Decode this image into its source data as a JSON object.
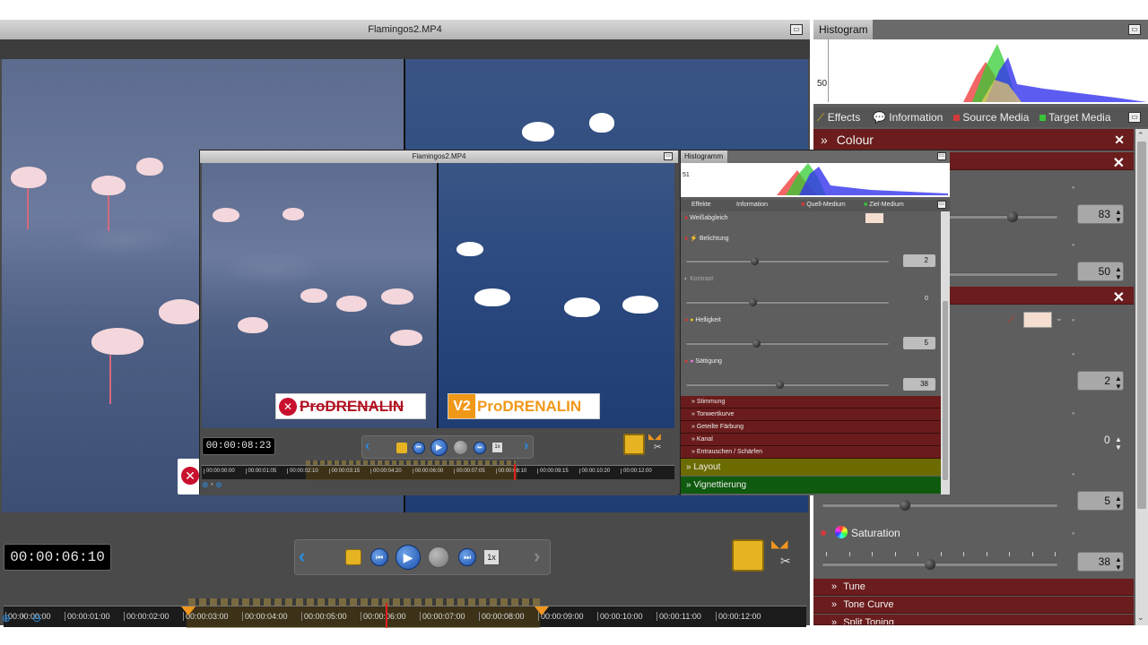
{
  "main_window": {
    "title": "Flamingos2.MP4",
    "timecode": "00:00:06:10",
    "speed_label": "1x",
    "timeline_labels": [
      "00:00:00:00",
      "00:00:01:00",
      "00:00:02:00",
      "00:00:03:00",
      "00:00:04:00",
      "00:00:05:00",
      "00:00:06:00",
      "00:00:07:00",
      "00:00:08:00",
      "00:00:09:00",
      "00:00:10:00",
      "00:00:11:00",
      "00:00:12:00"
    ],
    "zoom_separator": "*"
  },
  "right_panel": {
    "histogram_title": "Histogram",
    "histogram_scale": "50",
    "tabs": [
      {
        "label": "Effects",
        "color": "#e6b422"
      },
      {
        "label": "Information",
        "color": "#dfe8f6"
      },
      {
        "label": "Source Media",
        "color": "#d23a3a"
      },
      {
        "label": "Target Media",
        "color": "#3ac23a"
      }
    ],
    "colour_header": "Colour",
    "values": {
      "v1": "83",
      "v2": "50",
      "v3": "2",
      "v4": "0",
      "v5": "5",
      "v6": "38"
    },
    "saturation_label": "Saturation",
    "sections": [
      "Tune",
      "Tone Curve",
      "Split Toning"
    ]
  },
  "popup": {
    "title": "Flamingos2.MP4",
    "timecode": "00:00:08:23",
    "speed_label": "1x",
    "histogram_title": "Histogramm",
    "histogram_scale": "51",
    "tabs": [
      "Effekte",
      "Information",
      "Quell-Medium",
      "Ziel-Medium"
    ],
    "white_balance": "Weißabgleich",
    "rows": [
      {
        "label": "Belichtung",
        "value": "2"
      },
      {
        "label": "Kontrast",
        "value": "0"
      },
      {
        "label": "Helligkeit",
        "value": "5"
      },
      {
        "label": "Sättigung",
        "value": "38"
      }
    ],
    "sections": [
      "Stimmung",
      "Tonwertkurve",
      "Geteilte Färbung",
      "Kanal",
      "Entrauschen / Schärfen"
    ],
    "layout_label": "Layout",
    "vignette_label": "Vignettierung",
    "timeline_labels": [
      "00:00:00:00",
      "00:00:01:05",
      "00:00:02:10",
      "00:00:03:15",
      "00:00:04:20",
      "00:00:06:00",
      "00:00:07:05",
      "00:00:08:10",
      "00:00:09:15",
      "00:00:10:20",
      "00:00:12:00"
    ],
    "watermark_left": "ProDRENALIN",
    "watermark_right_prefix": "V2",
    "watermark_right": "ProDRENALIN"
  },
  "colors": {
    "accent_red_bar": "#6b1c1c",
    "layout_bar": "#6b6b00",
    "vignette_bar": "#0f5a0f",
    "playhead": "#e02020",
    "range_marker": "#f0961e"
  }
}
